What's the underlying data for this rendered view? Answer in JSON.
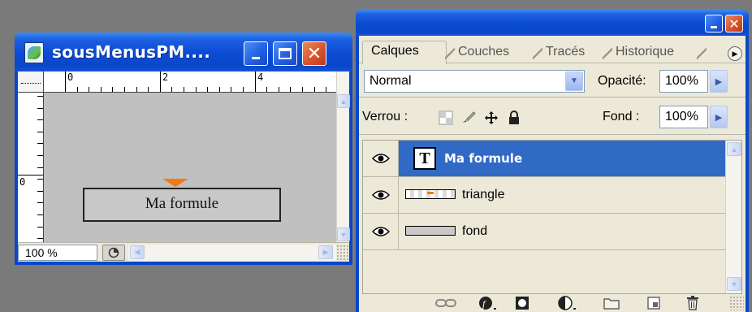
{
  "document_window": {
    "title": "sousMenusPM....",
    "ruler_top_labels": [
      "0",
      "2",
      "4"
    ],
    "ruler_left_label": "0",
    "canvas_text": "Ma formule",
    "zoom": "100 %",
    "buttons": {
      "minimize": "_",
      "maximize": "□",
      "close": "✕"
    }
  },
  "layers_panel": {
    "buttons": {
      "minimize": "_",
      "close": "✕"
    },
    "tabs": [
      {
        "label": "Calques",
        "active": true
      },
      {
        "label": "Couches",
        "active": false
      },
      {
        "label": "Tracés",
        "active": false
      },
      {
        "label": "Historique",
        "active": false
      }
    ],
    "blend_mode": "Normal",
    "opacity_label": "Opacité:",
    "opacity_value": "100%",
    "lock_label": "Verrou :",
    "fill_label": "Fond :",
    "fill_value": "100%",
    "lock_icons": [
      "lock-transparency-icon",
      "lock-paint-brush-icon",
      "lock-move-icon",
      "lock-all-padlock-icon"
    ],
    "layers": [
      {
        "name": "Ma formule",
        "type": "text",
        "visible": true,
        "selected": true
      },
      {
        "name": "triangle",
        "type": "shape",
        "visible": true,
        "selected": false
      },
      {
        "name": "fond",
        "type": "shape",
        "visible": true,
        "selected": false
      }
    ],
    "bottom_icons": [
      "link-layers-icon",
      "layer-style-icon",
      "layer-mask-icon",
      "adjustment-layer-icon",
      "new-group-folder-icon",
      "new-layer-icon",
      "delete-layer-trash-icon"
    ]
  },
  "colors": {
    "titlebar_blue": "#0a47c8",
    "selection_blue": "#316ac5",
    "close_red": "#d8542c",
    "triangle_orange": "#f27a12",
    "canvas_gray": "#c0c0c0"
  }
}
